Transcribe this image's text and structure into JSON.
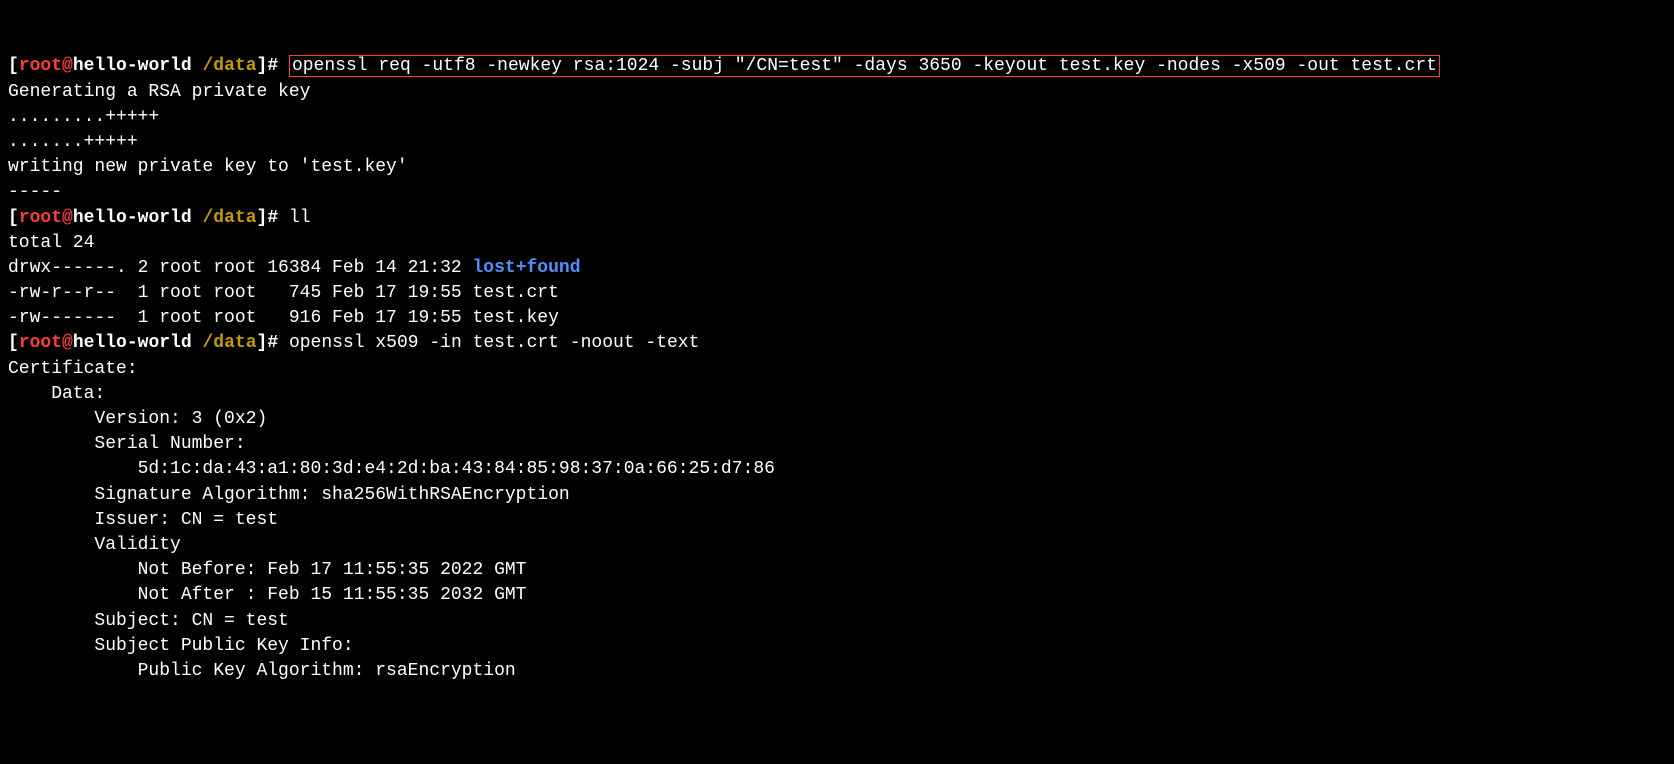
{
  "prompt": {
    "bracket_open": "[",
    "user": "root",
    "at": "@",
    "host": "hello-world",
    "space": " ",
    "path": "/data",
    "bracket_close": "]",
    "hash": "#"
  },
  "line1": {
    "cmd": "openssl req -utf8 -newkey rsa:1024 -subj \"/CN=test\" -days 3650 -keyout test.key -nodes -x509 -out test.crt"
  },
  "out1": {
    "l1": "Generating a RSA private key",
    "l2": ".........+++++",
    "l3": ".......+++++",
    "l4": "writing new private key to 'test.key'",
    "l5": "-----"
  },
  "line2": {
    "cmd": "ll"
  },
  "ls": {
    "total": "total 24",
    "r1a": "drwx------. 2 root root 16384 Feb 14 21:32 ",
    "r1b": "lost+found",
    "r2": "-rw-r--r--  1 root root   745 Feb 17 19:55 test.crt",
    "r3": "-rw-------  1 root root   916 Feb 17 19:55 test.key"
  },
  "line3": {
    "cmd": "openssl x509 -in test.crt -noout -text"
  },
  "cert": {
    "l1": "Certificate:",
    "l2": "    Data:",
    "l3": "        Version: 3 (0x2)",
    "l4": "        Serial Number:",
    "l5": "            5d:1c:da:43:a1:80:3d:e4:2d:ba:43:84:85:98:37:0a:66:25:d7:86",
    "l6": "        Signature Algorithm: sha256WithRSAEncryption",
    "l7": "        Issuer: CN = test",
    "l8": "        Validity",
    "l9": "            Not Before: Feb 17 11:55:35 2022 GMT",
    "l10": "            Not After : Feb 15 11:55:35 2032 GMT",
    "l11": "        Subject: CN = test",
    "l12": "        Subject Public Key Info:",
    "l13": "            Public Key Algorithm: rsaEncryption"
  }
}
